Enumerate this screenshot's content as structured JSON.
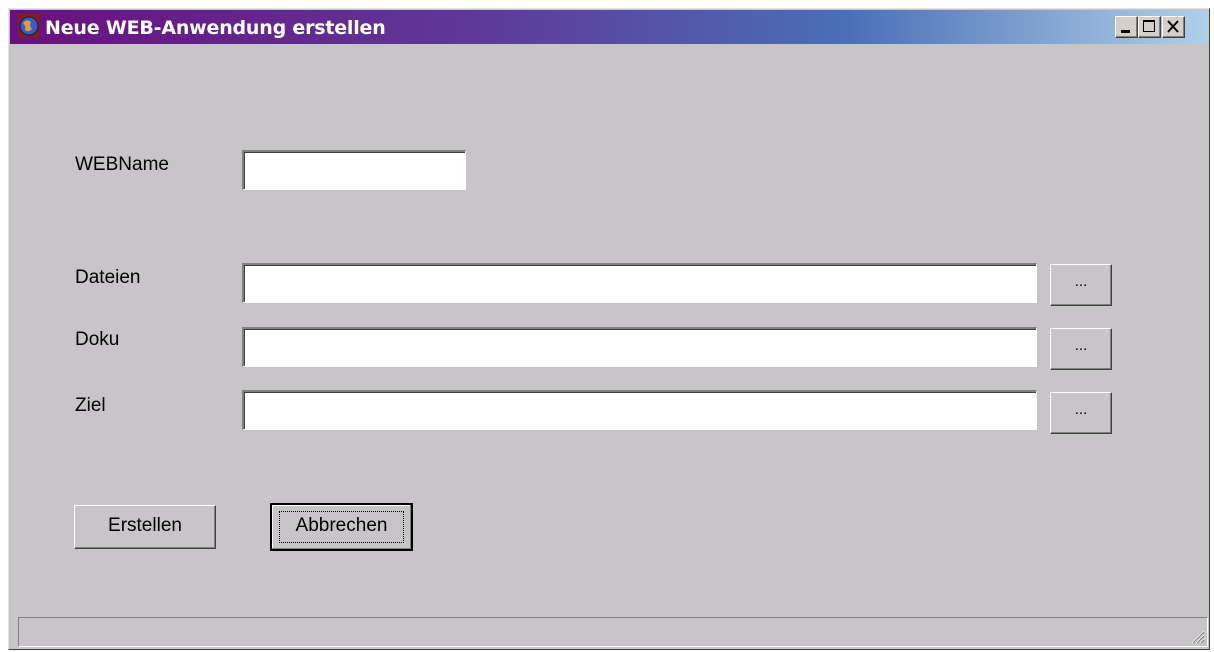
{
  "window": {
    "title": "Neue WEB-Anwendung erstellen",
    "controls": [
      "minimize-icon",
      "maximize-icon",
      "close-icon"
    ]
  },
  "form": {
    "webname": {
      "label": "WEBName",
      "value": ""
    },
    "dateien": {
      "label": "Dateien",
      "value": "",
      "browse_label": "..."
    },
    "doku": {
      "label": "Doku",
      "value": "",
      "browse_label": "..."
    },
    "ziel": {
      "label": "Ziel",
      "value": "",
      "browse_label": "..."
    }
  },
  "actions": {
    "create_label": "Erstellen",
    "cancel_label": "Abbrechen"
  },
  "statusbar": {
    "text": ""
  },
  "colors": {
    "window_bg": "#c8c5c8",
    "title_gradient_start": "#6b0f80",
    "title_gradient_end": "#b0d0e8",
    "title_text": "#ffffff"
  }
}
